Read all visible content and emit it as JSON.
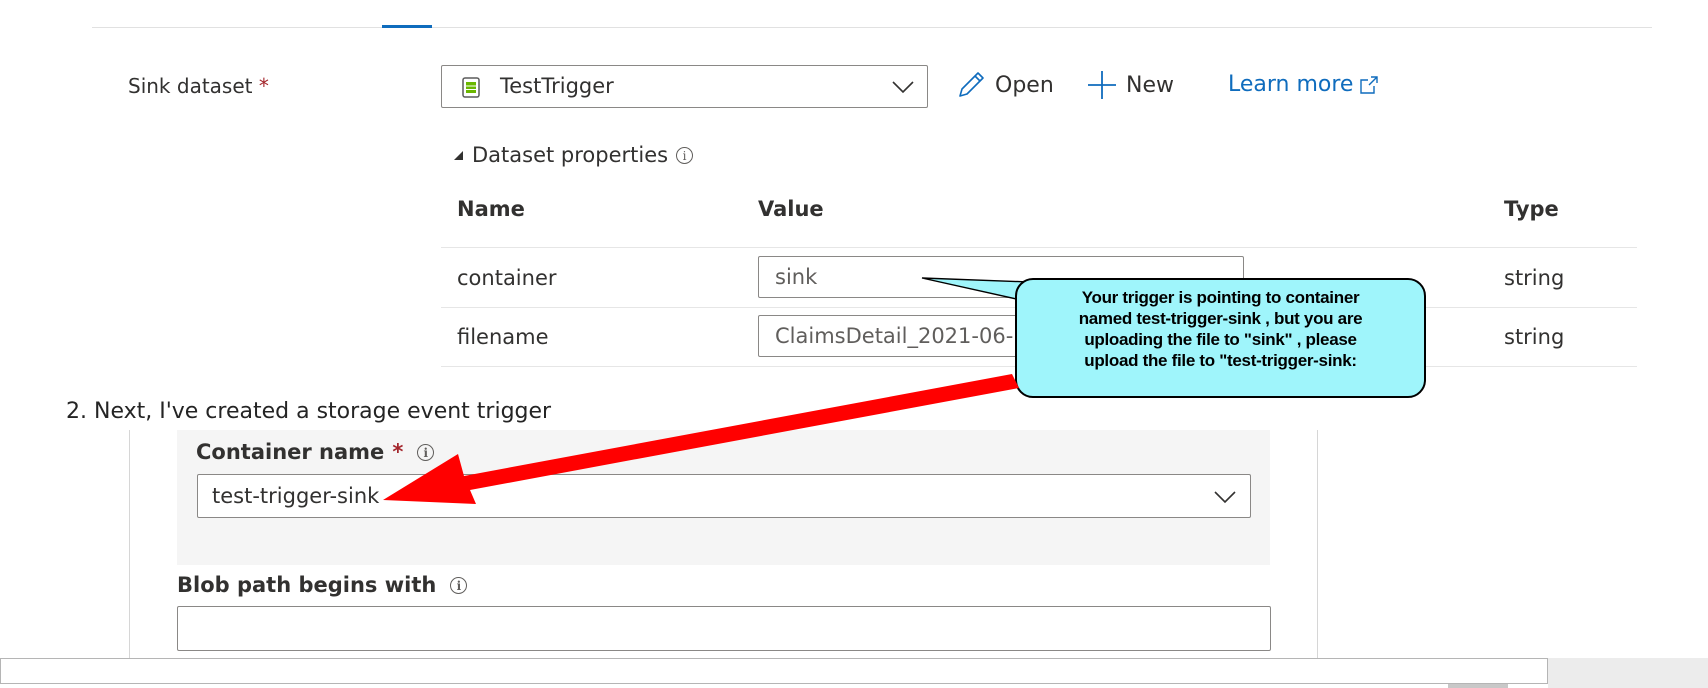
{
  "sink": {
    "label": "Sink dataset",
    "required": "*",
    "dataset_value": "TestTrigger",
    "open_label": "Open",
    "new_label": "New",
    "learn_more_label": "Learn more"
  },
  "dataset_properties": {
    "title": "Dataset properties",
    "columns": [
      "Name",
      "Value",
      "Type"
    ],
    "rows": [
      {
        "name": "container",
        "value": "sink",
        "type": "string"
      },
      {
        "name": "filename",
        "value": "ClaimsDetail_2021-06-",
        "type": "string"
      }
    ]
  },
  "callout": {
    "lines": [
      "Your trigger is pointing to container",
      "named test-trigger-sink , but you are",
      "uploading the file to \"sink\" , please",
      "upload the file to \"test-trigger-sink:"
    ]
  },
  "step2": {
    "text": "2. Next, I've created a storage event trigger"
  },
  "trigger": {
    "container_label": "Container name",
    "required": "*",
    "container_value": "test-trigger-sink",
    "blob_label": "Blob path begins with",
    "blob_value": ""
  },
  "colors": {
    "accent": "#0f6cbd",
    "callout_bg": "#9ff5fb",
    "arrow": "#ff0000"
  }
}
